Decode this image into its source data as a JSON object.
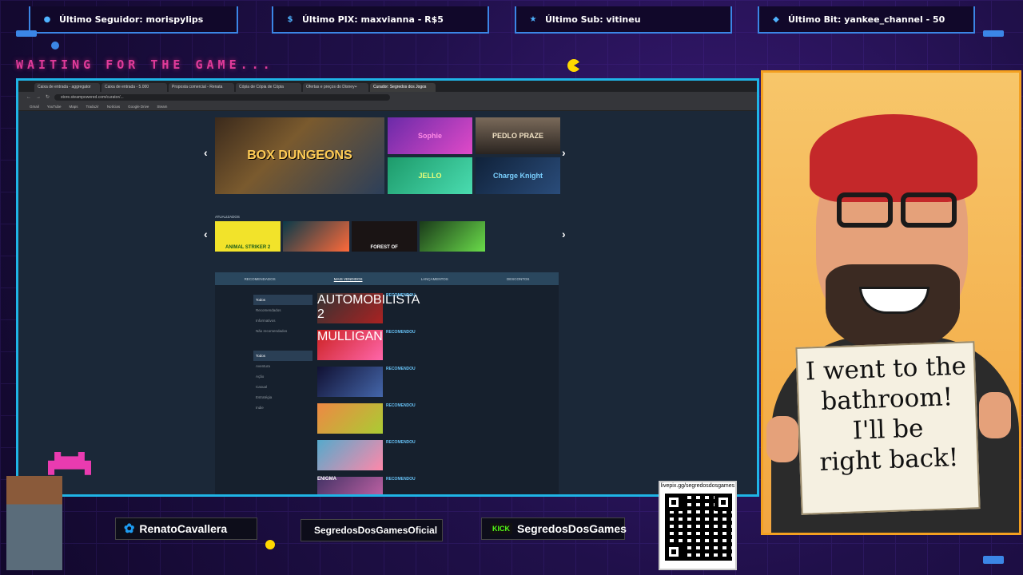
{
  "alerts": {
    "follower": "Último Seguidor: morispylips",
    "pix": "Último PIX: maxvianna - R$5",
    "sub": "Último Sub: vitineu",
    "bit": "Último Bit: yankee_channel - 50"
  },
  "waiting_text": "WAITING FOR THE GAME...",
  "browser": {
    "tabs": [
      "Caixa de entrada - aggregator",
      "Caixa de entrada - 5.000",
      "Proposta comercial - Renata",
      "Cópia de Cópia de Cópia",
      "Ofertas e preços do Disney+",
      "Curador: Segredos dos Jogos"
    ],
    "url": "store.steampowered.com/curator/...",
    "bookmarks": [
      "Gmail",
      "YouTube",
      "Maps",
      "Traduzir",
      "Notícias",
      "Google Drive",
      "Steam"
    ]
  },
  "steam": {
    "featured_main": "BOX DUNGEONS",
    "featured_tiles": [
      "Sophie",
      "PEDLO PRAZE",
      "JELLO",
      "Charge Knight"
    ],
    "section_title": "ATUALIZADOS",
    "row_items": [
      "ANIMAL STRIKER 2",
      "",
      "FOREST OF",
      ""
    ],
    "tabs": [
      "RECOMENDADOS",
      "MAIS VENDIDOS",
      "LANÇAMENTOS",
      "DESCONTOS"
    ],
    "filters": [
      "Todos",
      "Recomendados",
      "Informativos",
      "Não recomendados",
      "Todos",
      "Aventura",
      "Ação",
      "Casual",
      "Estratégia",
      "Indie"
    ],
    "recommend_label": "RECOMENDOU",
    "recs": [
      "AUTOMOBILISTA 2",
      "MULLIGAN",
      "",
      "",
      "",
      "ENIGMA"
    ]
  },
  "sign": {
    "lines": [
      "I went to the",
      "bathroom!",
      "I'll be",
      "right back!"
    ]
  },
  "socials": {
    "twitter": "RenatoCavallera",
    "instagram": "SegredosDosGamesOficial",
    "kick_logo": "KICK",
    "kick": "SegredosDosGames"
  },
  "qr": {
    "url": "livepix.gg/segredosdosgames"
  },
  "colors": {
    "accent_blue": "#3b86e6",
    "frame_cyan": "#1fb4e6",
    "waiting_pink": "#e03b9a",
    "card_orange": "#f4a020"
  }
}
